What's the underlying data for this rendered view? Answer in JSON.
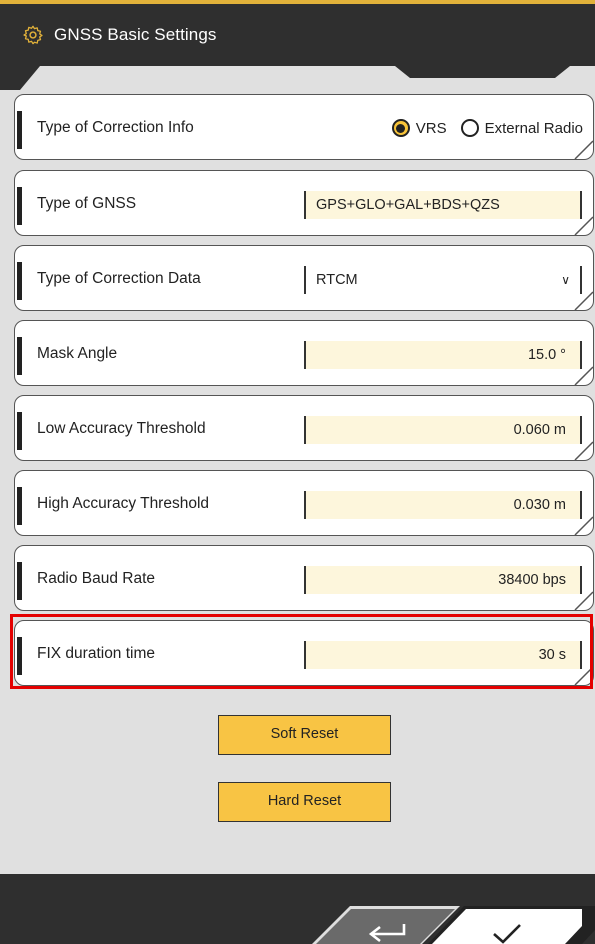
{
  "header": {
    "title": "GNSS Basic Settings",
    "icon": "gear-icon"
  },
  "rows": [
    {
      "label": "Type of Correction Info",
      "type": "radio",
      "options": [
        "VRS",
        "External Radio"
      ],
      "selected": "VRS"
    },
    {
      "label": "Type of GNSS",
      "type": "text",
      "value": "GPS+GLO+GAL+BDS+QZS"
    },
    {
      "label": "Type of Correction Data",
      "type": "select",
      "value": "RTCM"
    },
    {
      "label": "Mask Angle",
      "type": "number",
      "value": "15.0 °"
    },
    {
      "label": "Low Accuracy Threshold",
      "type": "number",
      "value": "0.060 m"
    },
    {
      "label": "High Accuracy Threshold",
      "type": "number",
      "value": "0.030 m"
    },
    {
      "label": "Radio Baud Rate",
      "type": "number",
      "value": "38400 bps"
    },
    {
      "label": "FIX duration time",
      "type": "number",
      "value": "30 s"
    }
  ],
  "buttons": {
    "soft_reset": "Soft Reset",
    "hard_reset": "Hard Reset"
  },
  "footer": {
    "back_icon": "return-arrow-icon",
    "confirm_icon": "checkmark-icon"
  },
  "colors": {
    "accent": "#f8c444",
    "header_bg": "#2f2f2f",
    "highlight": "#e40000",
    "field_bg": "#fdf6dc"
  }
}
